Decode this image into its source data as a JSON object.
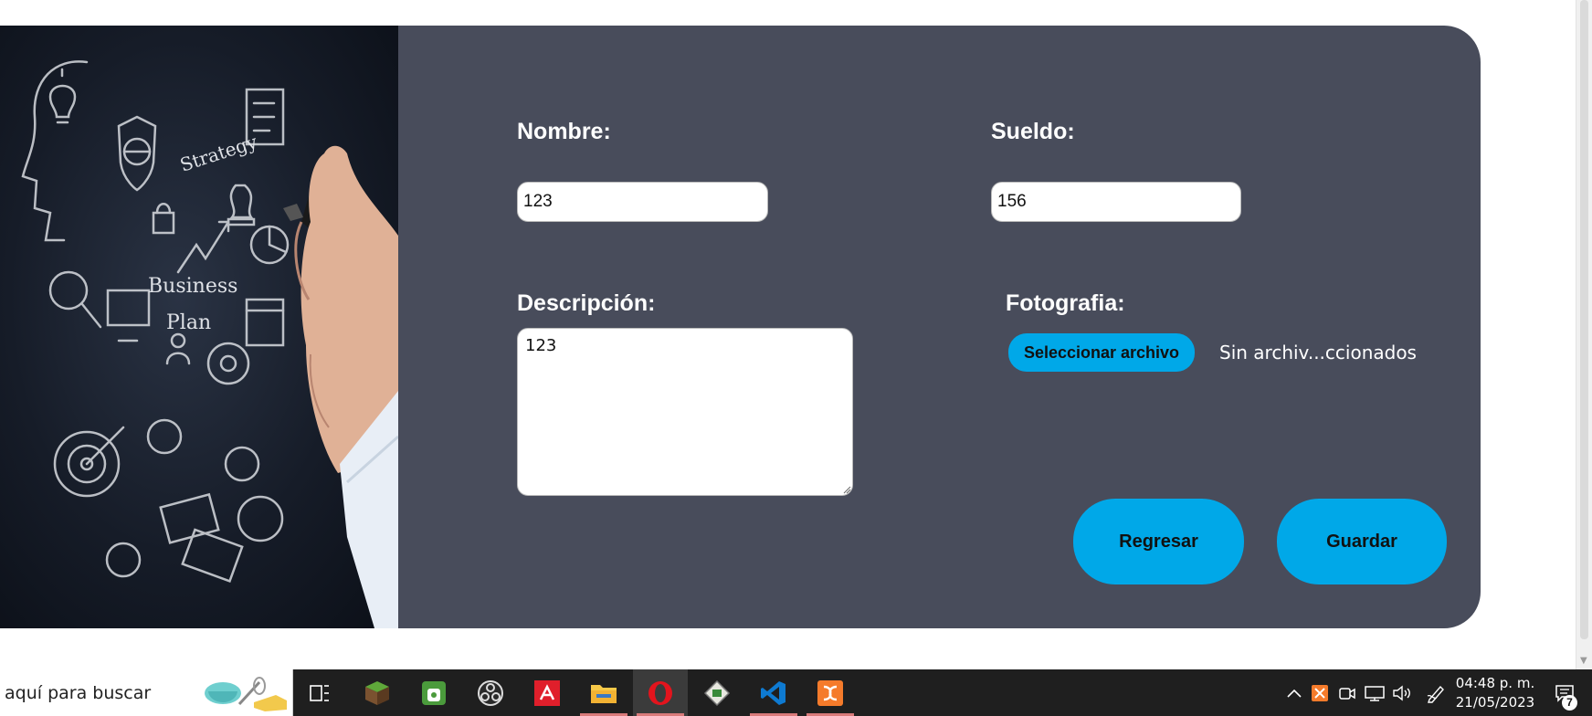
{
  "form": {
    "nombre_label": "Nombre:",
    "nombre_value": "123",
    "sueldo_label": "Sueldo:",
    "sueldo_value": "156",
    "descripcion_label": "Descripción:",
    "descripcion_value": "123",
    "fotografia_label": "Fotografia:",
    "file_button_label": "Seleccionar archivo",
    "file_status": "Sin archiv...ccionados",
    "regresar_label": "Regresar",
    "guardar_label": "Guardar"
  },
  "image": {
    "texts": [
      "Strategy",
      "Business",
      "Plan"
    ]
  },
  "taskbar": {
    "search_placeholder": "aquí para buscar",
    "time": "04:48 p. m.",
    "date": "21/05/2023",
    "notification_count": "7",
    "icons": [
      "task-view-icon",
      "minecraft-icon",
      "android-studio-icon",
      "obs-icon",
      "amd-icon",
      "file-explorer-icon",
      "opera-icon",
      "pixel-app-icon",
      "vscode-icon",
      "xampp-icon"
    ]
  },
  "colors": {
    "card_bg": "#484c5b",
    "accent": "#00a8e8",
    "taskbar_bg": "#1f1f1f"
  }
}
